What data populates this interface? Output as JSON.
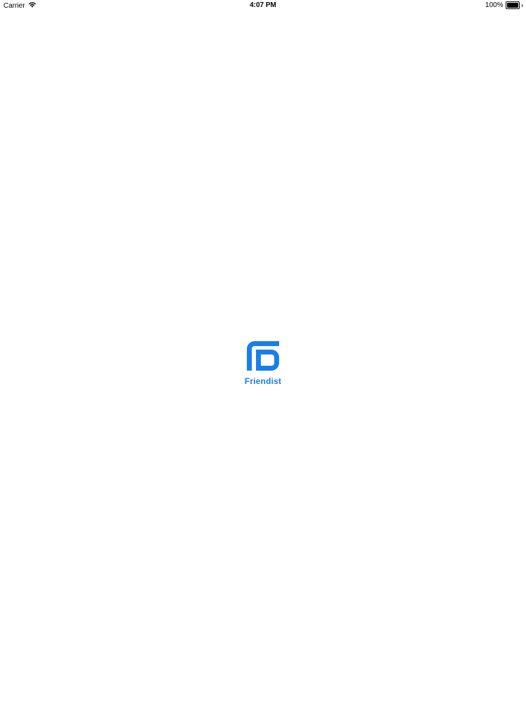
{
  "status_bar": {
    "carrier": "Carrier",
    "time": "4:07 PM",
    "battery_percent_label": "100%",
    "battery_level": 1.0
  },
  "splash": {
    "app_name": "Friendist",
    "logo_icon": "friendist-logo-icon"
  },
  "colors": {
    "brand": "#1a7fe8",
    "background": "#ffffff",
    "status_text": "#000000"
  }
}
